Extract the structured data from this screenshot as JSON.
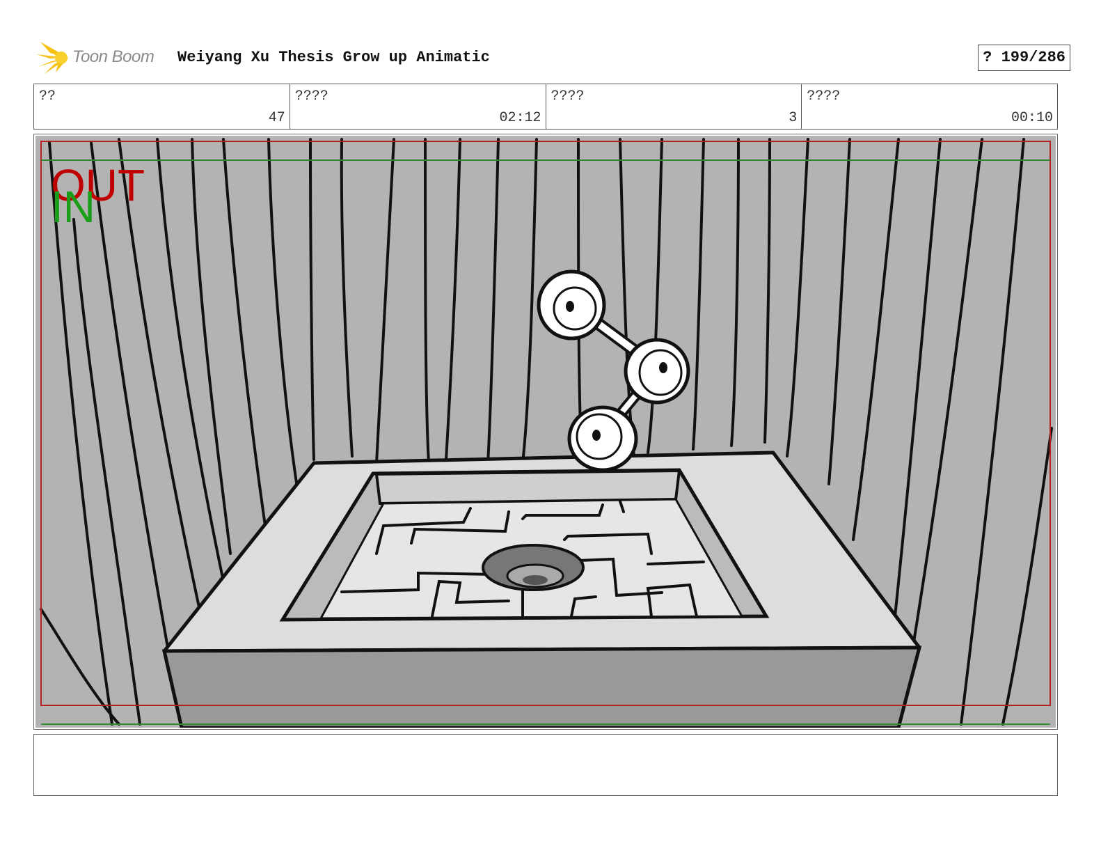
{
  "header": {
    "logo_text": "Toon Boom",
    "title": "Weiyang Xu Thesis Grow up Animatic",
    "page_indicator": "? 199/286"
  },
  "info": [
    {
      "label": "??",
      "value": "47"
    },
    {
      "label": "????",
      "value": "02:12"
    },
    {
      "label": "????",
      "value": "3"
    },
    {
      "label": "????",
      "value": "00:10"
    }
  ],
  "panel": {
    "out_label": "OUT",
    "in_label": "IN",
    "colors": {
      "out": "#c00000",
      "in": "#1a9e1a",
      "safe_red": "#b22222",
      "safe_green": "#2e8b2e"
    }
  },
  "notes": {
    "text": ""
  },
  "logo_icon": "toon-boom-burst-icon"
}
